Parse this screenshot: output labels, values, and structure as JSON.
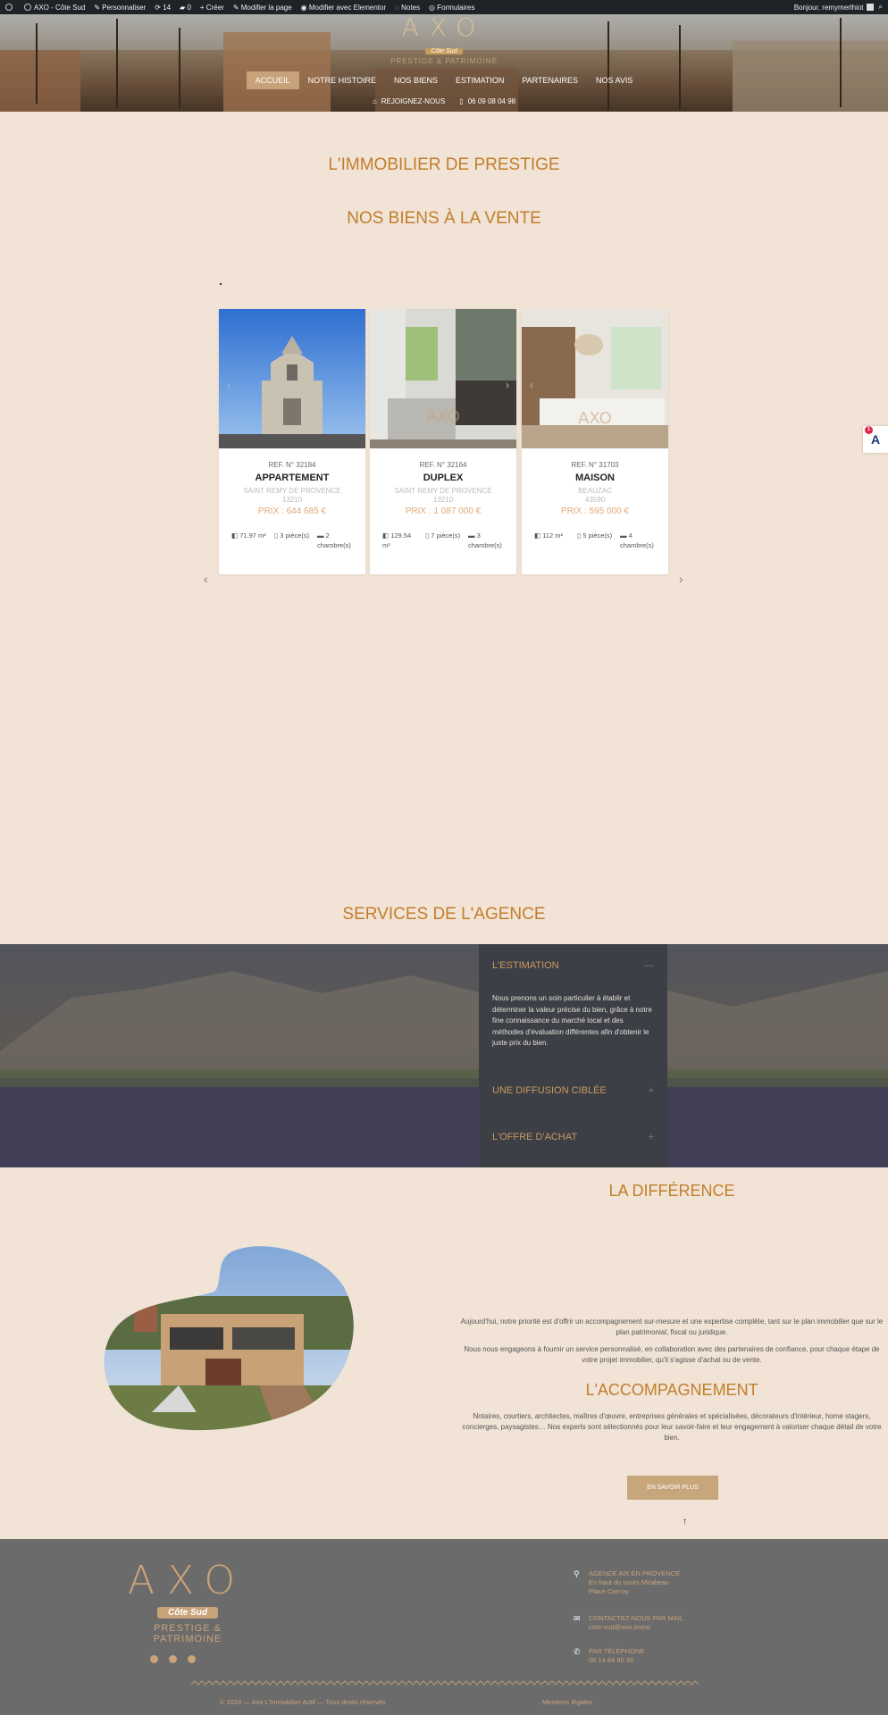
{
  "adminbar": {
    "site": "AXO - Côte Sud",
    "customize": "Personnaliser",
    "updates": "14",
    "comments": "0",
    "new": "Créer",
    "edit_page": "Modifier la page",
    "edit_elementor": "Modifier avec Elementor",
    "notes": "Notes",
    "forms": "Formulaires",
    "greeting": "Bonjour, remymerlhiot"
  },
  "header": {
    "logo": "AXO",
    "badge": "Côte Sud",
    "tagline": "PRESTIGE & PATRIMOINE",
    "nav": [
      "ACCUEIL",
      "NOTRE HISTOIRE",
      "NOS BIENS",
      "ESTIMATION",
      "PARTENAIRES",
      "NOS AVIS"
    ],
    "join": "REJOIGNEZ-NOUS",
    "phone": "06 09 08 04 98"
  },
  "sections": {
    "prestige": "L'IMMOBILIER DE PRESTIGE",
    "for_sale": "NOS BIENS À LA VENTE",
    "services": "SERVICES DE L'AGENCE",
    "difference": "LA DIFFÉRENCE",
    "accompagnement": "L'ACCOMPAGNEMENT"
  },
  "properties": [
    {
      "ref": "REF. N° 32184",
      "type": "APPARTEMENT",
      "city": "SAINT REMY DE PROVENCE",
      "zip": "13210",
      "price": "PRIX : 644 685 €",
      "area": "71.97 m²",
      "rooms": "3 pièce(s)",
      "bedrooms": "2 chambre(s)"
    },
    {
      "ref": "REF. N° 32164",
      "type": "DUPLEX",
      "city": "SAINT REMY DE PROVENCE",
      "zip": "13210",
      "price": "PRIX : 1 087 000 €",
      "area": "129.54 m²",
      "rooms": "7 pièce(s)",
      "bedrooms": "3 chambre(s)"
    },
    {
      "ref": "REF. N° 31703",
      "type": "MAISON",
      "city": "BEAUZAC",
      "zip": "43590",
      "price": "PRIX : 595 000 €",
      "area": "112 m²",
      "rooms": "5 pièce(s)",
      "bedrooms": "4 chambre(s)"
    }
  ],
  "badge_count": "1",
  "services": {
    "items": [
      {
        "title": "L'ESTIMATION",
        "sign": "—",
        "body": "Nous prenons un soin particulier à établir et déterminer la valeur précise du bien, grâce à notre fine connaissance du marché local et des méthodes d'évaluation différentes afin d'obtenir le juste prix du bien."
      },
      {
        "title": "UNE DIFFUSION CIBLÉE",
        "sign": "+"
      },
      {
        "title": "L'OFFRE D'ACHAT",
        "sign": "+"
      }
    ]
  },
  "difference": {
    "p1": "Aujourd'hui, notre priorité est d'offrir un accompagnement sur-mesure et une expertise complète, tant sur le plan immobilier que sur le plan patrimonial, fiscal ou juridique.",
    "p2": "Nous nous engageons à fournir un service personnalisé, en collaboration avec des partenaires de confiance, pour chaque étape de votre projet immobilier, qu'il s'agisse d'achat ou de vente.",
    "p3": "Notaires, courtiers, architectes, maîtres d'œuvre, entreprises générales et spécialisées, décorateurs d'intérieur, home stagers, concierges, paysagistes… Nos experts sont sélectionnés pour leur savoir-faire et leur engagement à valoriser chaque détail de votre bien.",
    "button": "EN SAVOIR PLUS",
    "up": "↑"
  },
  "footer": {
    "logo": "AXO",
    "badge": "Côte Sud",
    "tagline": "PRESTIGE & PATRIMOINE",
    "agency_label": "AGENCE AIX EN PROVENCE",
    "agency_addr1": "En haut du cours Mirabeau",
    "agency_addr2": "Place Cornay",
    "mail_label": "CONTACTEZ-NOUS PAR MAIL",
    "mail": "cote-sud@axo.immo",
    "phone_label": "PAR TÉLÉPHONE",
    "phone": "06 14 84 90 35",
    "copyright": "© 2024 — Axo L'Immobilier Actif — Tous droits réservés",
    "legal": "Mentions légales"
  },
  "colors": {
    "accent": "#c27e2c",
    "background": "#f1e3d5",
    "footer": "#6b6b6b",
    "gold": "#c9a37a"
  }
}
